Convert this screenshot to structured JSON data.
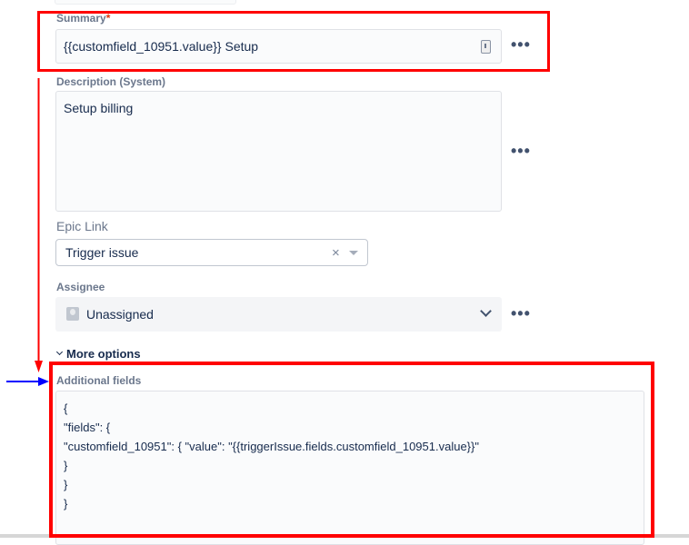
{
  "summary": {
    "label": "Summary",
    "required_mark": "*",
    "value": "{{customfield_10951.value}} Setup"
  },
  "description": {
    "label": "Description (System)",
    "value": "Setup billing"
  },
  "epic_link": {
    "label": "Epic Link",
    "value": "Trigger issue",
    "clear": "×"
  },
  "assignee": {
    "label": "Assignee",
    "value": "Unassigned"
  },
  "more_options": {
    "label": "More options"
  },
  "additional_fields": {
    "label": "Additional fields",
    "lines": [
      "{",
      "\"fields\": {",
      "\"customfield_10951\": { \"value\": \"{{triggerIssue.fields.customfield_10951.value}}\"",
      "}",
      "}",
      "}"
    ]
  },
  "more_actions": "•••",
  "colors": {
    "annotation_red": "#ff0000",
    "annotation_blue": "#0000ff"
  }
}
